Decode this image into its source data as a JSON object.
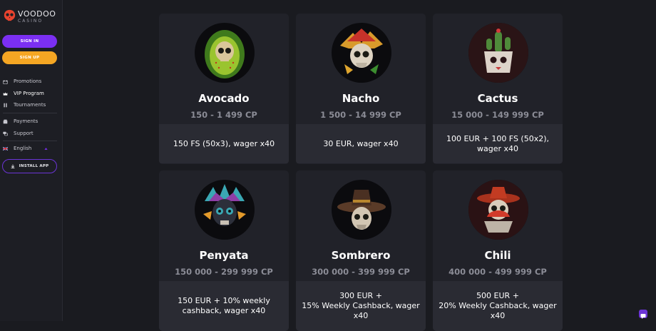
{
  "brand": {
    "name": "VOODOO",
    "sub": "CASINO"
  },
  "auth": {
    "signin_label": "SIGN IN",
    "signup_label": "SIGN UP"
  },
  "nav": {
    "promotions": "Promotions",
    "vip": "VIP Program",
    "tournaments": "Tournaments",
    "payments": "Payments",
    "support": "Support",
    "language": "English"
  },
  "install_label": "INSTALL APP",
  "colors": {
    "accent": "#7b2ff2",
    "signup": "#f5a623",
    "bg": "#1a1b20",
    "card": "#212229"
  },
  "levels": [
    {
      "name": "Avocado",
      "range": "150 - 1 499 CP",
      "reward": "150 FS (50x3), wager x40",
      "icon": "avocado-skull-icon"
    },
    {
      "name": "Nacho",
      "range": "1 500 - 14 999 CP",
      "reward": "30 EUR, wager x40",
      "icon": "nacho-skull-icon"
    },
    {
      "name": "Cactus",
      "range": "15 000 - 149 999 CP",
      "reward": "100 EUR + 100 FS (50x2),\nwager x40",
      "icon": "cactus-skull-icon"
    },
    {
      "name": "Penyata",
      "range": "150 000 - 299 999 CP",
      "reward": "150 EUR + 10% weekly\ncashback, wager x40",
      "icon": "penyata-skull-icon"
    },
    {
      "name": "Sombrero",
      "range": "300 000 - 399 999 CP",
      "reward": "300 EUR +\n15% Weekly Cashback, wager\nx40",
      "icon": "sombrero-skull-icon"
    },
    {
      "name": "Chili",
      "range": "400 000 - 499 999 CP",
      "reward": "500 EUR +\n20% Weekly Cashback, wager\nx40",
      "icon": "chili-skull-icon"
    }
  ]
}
